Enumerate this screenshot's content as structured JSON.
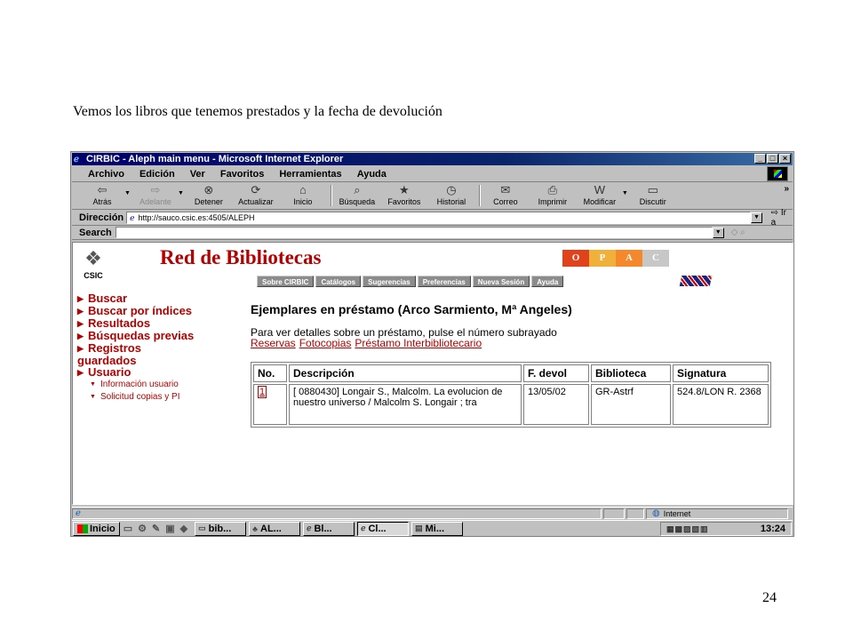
{
  "caption": "Vemos los libros que tenemos prestados y la fecha de devolución",
  "page_number": "24",
  "window": {
    "title": "CIRBIC - Aleph main menu - Microsoft Internet Explorer",
    "buttons": [
      "_",
      "□",
      "×"
    ]
  },
  "menu": [
    "Archivo",
    "Edición",
    "Ver",
    "Favoritos",
    "Herramientas",
    "Ayuda"
  ],
  "toolbar": {
    "back": "Atrás",
    "forward": "Adelante",
    "stop": "Detener",
    "refresh": "Actualizar",
    "home": "Inicio",
    "search": "Búsqueda",
    "favorites": "Favoritos",
    "history": "Historial",
    "mail": "Correo",
    "print": "Imprimir",
    "edit": "Modificar",
    "discuss": "Discutir",
    "chevron": "»"
  },
  "address": {
    "label": "Dirección",
    "url": "http://sauco.csic.es:4505/ALEPH",
    "go": "Ir a"
  },
  "search_bar": {
    "label": "Search"
  },
  "site": {
    "logo_text": "CSIC",
    "title": "Red de Bibliotecas",
    "opac": [
      {
        "letter": "O",
        "color": "#e0431b"
      },
      {
        "letter": "P",
        "color": "#f0b13a"
      },
      {
        "letter": "A",
        "color": "#f5882a"
      },
      {
        "letter": "C",
        "color": "#c7c7c7"
      }
    ],
    "tabs": [
      "Sobre CIRBIC",
      "Catálogos",
      "Sugerencias",
      "Preferencias",
      "Nueva Sesión",
      "Ayuda"
    ]
  },
  "sidenav": {
    "buscar": "Buscar",
    "buscar_indices": "Buscar por índices",
    "resultados": "Resultados",
    "busquedas_previas": "Búsquedas previas",
    "registros": "Registros",
    "guardados": "guardados",
    "usuario": "Usuario",
    "info_usuario": "Información usuario",
    "solicitud": "Solicitud copias y PI"
  },
  "main": {
    "heading": "Ejemplares en préstamo (Arco Sarmiento, Mª Angeles)",
    "instructions": "Para ver detalles sobre un préstamo, pulse el número subrayado",
    "links": [
      "Reservas",
      "Fotocopias",
      "Préstamo Interbibliotecario"
    ]
  },
  "loans": {
    "headers": [
      "No.",
      "Descripción",
      "F. devol",
      "Biblioteca",
      "Signatura"
    ],
    "rows": [
      {
        "no": "1",
        "descripcion": "[ 0880430] Longair S., Malcolm. La evolucion de nuestro universo / Malcolm S. Longair ; tra",
        "fecha": "13/05/02",
        "biblioteca": "GR-Astrf",
        "signatura": "524.8/LON R. 2368"
      }
    ]
  },
  "status": {
    "zone": "Internet"
  },
  "taskbar": {
    "start": "Inicio",
    "tasks": [
      "bib...",
      "AL...",
      "Bl...",
      "Cl...",
      "Mi..."
    ],
    "clock": "13:24"
  }
}
